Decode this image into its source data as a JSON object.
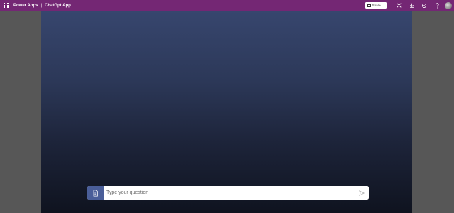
{
  "topbar": {
    "brand": "Power Apps",
    "separator": "|",
    "app_title": "ChatGpt App",
    "share_label": "Share",
    "icons": [
      "app-launcher-icon",
      "share-icon",
      "chevron-down-icon",
      "close-expand-icon",
      "download-icon",
      "settings-icon",
      "help-icon",
      "avatar"
    ]
  },
  "chat": {
    "placeholder": "Type your question",
    "value": "",
    "icons": [
      "document-icon",
      "send-icon"
    ]
  },
  "colors": {
    "topbar": "#742774",
    "background": "#575757",
    "canvas_top": "#37466e",
    "canvas_bottom": "#0f131f",
    "doc_button": "#4a5e99"
  }
}
